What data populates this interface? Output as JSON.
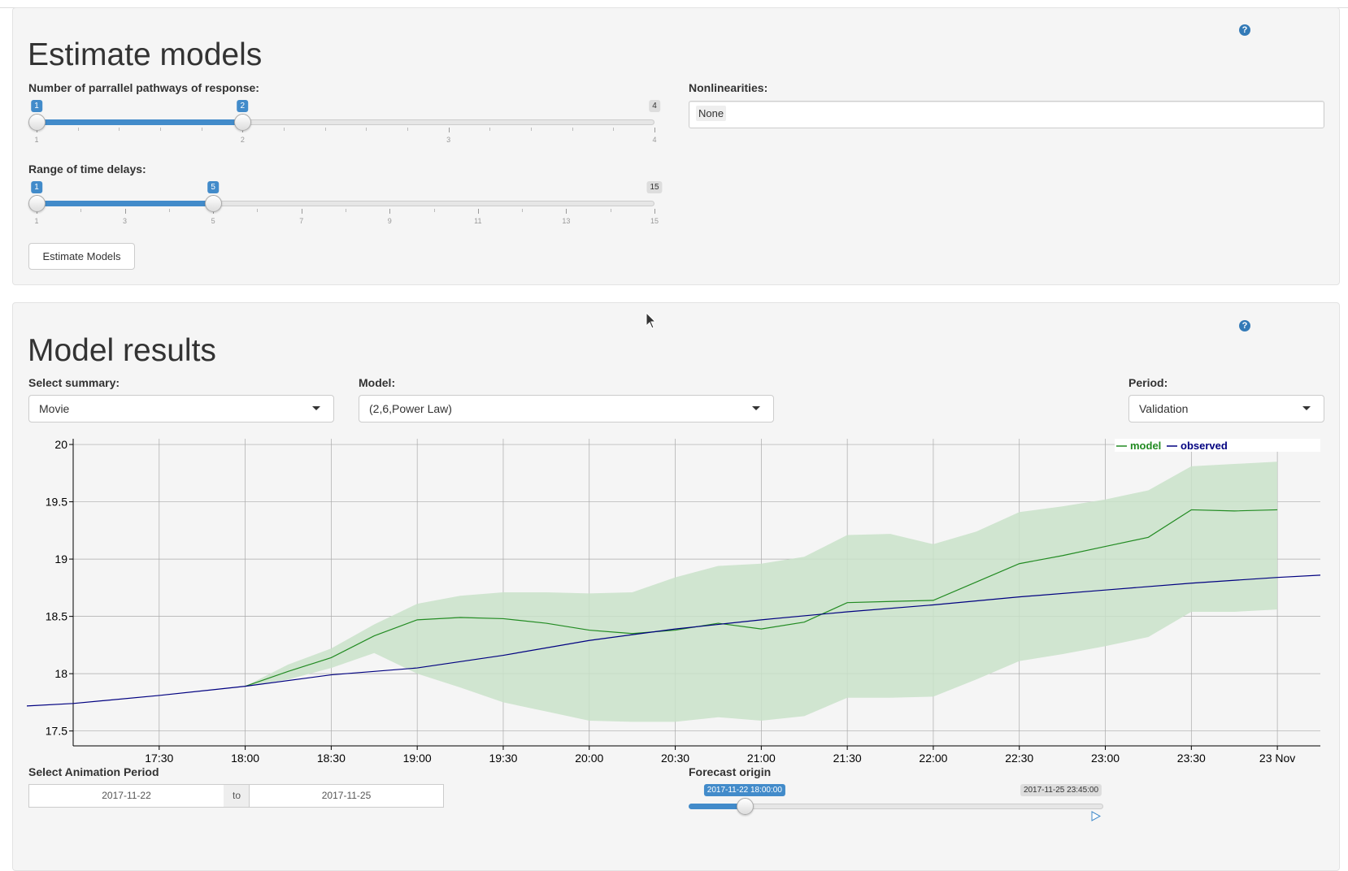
{
  "estimate": {
    "title": "Estimate models",
    "pathways": {
      "label": "Number of parrallel pathways of response:",
      "min": 1,
      "max": 4,
      "from": 1,
      "to": 2,
      "ticks": [
        "1",
        "2",
        "3",
        "4"
      ]
    },
    "delays": {
      "label": "Range of time delays:",
      "min": 1,
      "max": 15,
      "from": 1,
      "to": 5,
      "ticks": [
        "1",
        "3",
        "5",
        "7",
        "9",
        "11",
        "13",
        "15"
      ]
    },
    "nonlinearities": {
      "label": "Nonlinearities:",
      "value": "None"
    },
    "button": "Estimate Models"
  },
  "results": {
    "title": "Model results",
    "summary": {
      "label": "Select summary:",
      "value": "Movie"
    },
    "model": {
      "label": "Model:",
      "value": "(2,6,Power Law)"
    },
    "period": {
      "label": "Period:",
      "value": "Validation"
    },
    "animation": {
      "label": "Select Animation Period",
      "start": "2017-11-22",
      "sep": "to",
      "end": "2017-11-25"
    },
    "forecast": {
      "label": "Forecast origin",
      "value": "2017-11-22 18:00:00",
      "max": "2017-11-25 23:45:00",
      "fraction": 0.135
    }
  },
  "colors": {
    "accent": "#428bca",
    "model": "#228B22",
    "observed": "#000080",
    "band": "#c9e2c9"
  },
  "chart_data": {
    "type": "line",
    "x_ticks": [
      "17:30",
      "18:00",
      "18:30",
      "19:00",
      "19:30",
      "20:00",
      "20:30",
      "21:00",
      "21:30",
      "22:00",
      "22:30",
      "23:00",
      "23:30",
      "23 Nov"
    ],
    "ylim": [
      17.37,
      20.05
    ],
    "y_ticks": [
      "17.5",
      "18",
      "18.5",
      "19",
      "19.5",
      "20"
    ],
    "legend": {
      "position": "top-right"
    },
    "grid": true,
    "x": [
      17.0,
      17.25,
      17.5,
      17.75,
      18.0,
      18.25,
      18.5,
      18.75,
      19.0,
      19.25,
      19.5,
      19.75,
      20.0,
      20.25,
      20.5,
      20.75,
      21.0,
      21.25,
      21.5,
      21.75,
      22.0,
      22.25,
      22.5,
      22.75,
      23.0,
      23.25,
      23.5,
      23.75,
      24.0,
      24.25
    ],
    "series": [
      {
        "name": "model",
        "x": [
          18.0,
          18.25,
          18.5,
          18.75,
          19.0,
          19.25,
          19.5,
          19.75,
          20.0,
          20.25,
          20.5,
          20.75,
          21.0,
          21.25,
          21.5,
          21.75,
          22.0,
          22.25,
          22.5,
          22.75,
          23.0,
          23.25,
          23.5,
          23.75,
          24.0
        ],
        "values": [
          17.89,
          18.02,
          18.14,
          18.33,
          18.47,
          18.49,
          18.48,
          18.44,
          18.38,
          18.35,
          18.38,
          18.44,
          18.39,
          18.45,
          18.62,
          18.63,
          18.64,
          18.8,
          18.96,
          19.03,
          19.11,
          19.19,
          19.43,
          19.42,
          19.43
        ],
        "lower": [
          17.89,
          17.95,
          18.05,
          18.18,
          18.0,
          17.88,
          17.75,
          17.67,
          17.59,
          17.58,
          17.58,
          17.62,
          17.59,
          17.63,
          17.79,
          17.79,
          17.8,
          17.95,
          18.11,
          18.17,
          18.24,
          18.32,
          18.54,
          18.54,
          18.56
        ],
        "upper": [
          17.89,
          18.08,
          18.22,
          18.43,
          18.61,
          18.68,
          18.71,
          18.71,
          18.7,
          18.71,
          18.84,
          18.94,
          18.96,
          19.02,
          19.21,
          19.22,
          19.13,
          19.24,
          19.41,
          19.46,
          19.52,
          19.6,
          19.81,
          19.83,
          19.85
        ]
      },
      {
        "name": "observed",
        "x": [
          16.63,
          17.0,
          17.5,
          18.0,
          18.5,
          19.0,
          19.5,
          20.0,
          20.5,
          21.0,
          21.5,
          22.0,
          22.5,
          23.0,
          23.5,
          24.0,
          24.25
        ],
        "values": [
          17.71,
          17.74,
          17.81,
          17.89,
          17.99,
          18.05,
          18.16,
          18.29,
          18.39,
          18.47,
          18.54,
          18.6,
          18.67,
          18.73,
          18.79,
          18.84,
          18.86
        ]
      }
    ]
  }
}
